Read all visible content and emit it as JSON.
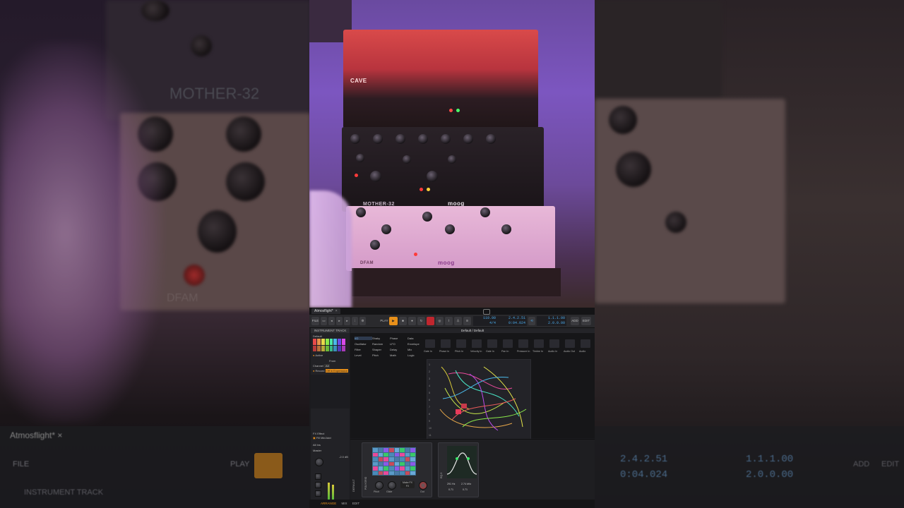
{
  "daw": {
    "tab_title": "Atmosflight",
    "tab_modified": "*",
    "tab_close": "×",
    "transport": {
      "file": "FILE",
      "play": "PLAY",
      "tempo": "110.00",
      "signature": "4/4",
      "position_bars": "2.4.2.51",
      "position_time": "0:04.024",
      "loop_start": "1.1.1.00",
      "loop_end": "2.0.0.00",
      "add": "ADD",
      "edit": "EDIT"
    },
    "inspector": {
      "header": "INSTRUMENT TRACK",
      "section": "Default",
      "active": "Active",
      "from_label": "From",
      "all_label": "All",
      "channel_label": "Channel",
      "record_label": "Record",
      "record_value": "Off in Expression",
      "fx_label": "FX Effect",
      "fx_tags": [
        "Fill",
        "Mid",
        "Add"
      ],
      "all_ins_label": "All Ins",
      "master_label": "Master",
      "meter_value": "-2.0 dB",
      "vu_level": 0.72
    },
    "grid": {
      "title": "Default / Default",
      "modules": [
        [
          "I/O",
          "Shaky",
          "Phase",
          "Data"
        ],
        [
          "Oscillator",
          "Random",
          "LFO",
          "Envelope"
        ],
        [
          "Filter",
          "Shaper",
          "Delay",
          "Mix"
        ],
        [
          "Level",
          "Pitch",
          "Math",
          "Logic"
        ]
      ],
      "io_labels": [
        "Gate In",
        "Phase In",
        "Pitch In",
        "Velocity In",
        "Gate In",
        "Pan In",
        "Pressure In",
        "Timbre In",
        "Audio In",
        "Audio Out",
        "Audio"
      ],
      "row_numbers": [
        "1",
        "2",
        "3",
        "4",
        "5",
        "6",
        "7",
        "8",
        "9",
        "10",
        "11"
      ]
    },
    "device": {
      "label": "DEFAULT",
      "panel_label": "POLYGRID",
      "knob_labels": [
        "Pitch",
        "Glide",
        "Make FX",
        "Out"
      ],
      "fx_btn": "FX",
      "eq_label": "EQ-5",
      "eq_values": [
        "291 Hz",
        "2.74 kHz"
      ],
      "eq_gain": [
        "0.71",
        "0.71"
      ]
    },
    "status": {
      "arrange": "ARRANGE",
      "mix": "MIX",
      "edit": "EDIT"
    }
  },
  "background_ghost": {
    "tab_title": "Atmosflight",
    "tab_modified": "*",
    "tab_close": "×",
    "file": "FILE",
    "play": "PLAY",
    "instrument_track": "INSTRUMENT TRACK",
    "pos_bars": "2.4.2.51",
    "pos_time": "0:04.024",
    "loop_start": "1.1.1.00",
    "loop_end": "2.0.0.00",
    "add": "ADD",
    "edit": "EDIT"
  },
  "photo": {
    "top_brand": "CAVE",
    "mid_name": "MOTHER-32",
    "mid_brand": "moog",
    "bot_name": "DFAM",
    "bot_brand": "moog"
  }
}
